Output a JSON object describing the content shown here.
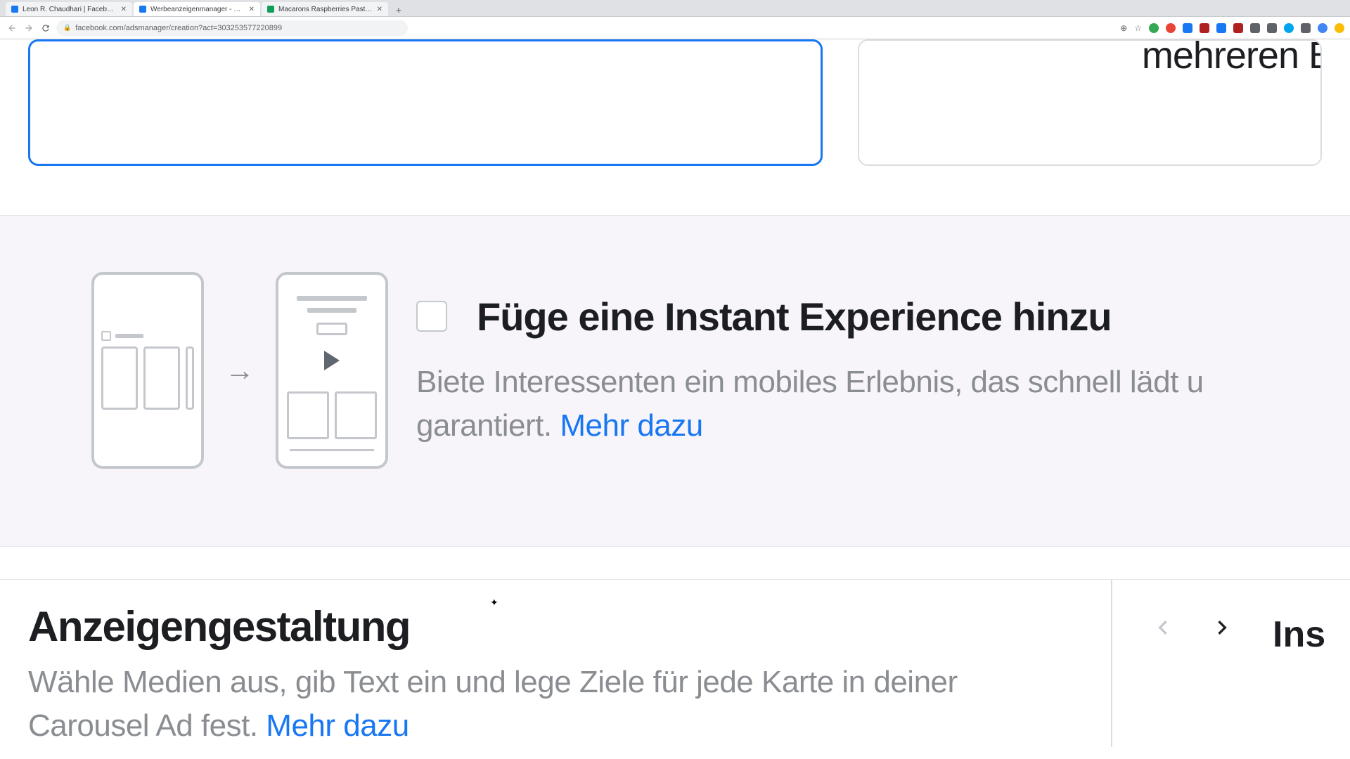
{
  "browser": {
    "tabs": [
      {
        "title": "Leon R. Chaudhari | Facebook",
        "active": false,
        "favicon": "blue"
      },
      {
        "title": "Werbeanzeigenmanager - Cre",
        "active": true,
        "favicon": "blue"
      },
      {
        "title": "Macarons Raspberries Pastries",
        "active": false,
        "favicon": "green"
      }
    ],
    "url": "facebook.com/adsmanager/creation?act=303253577220899"
  },
  "top_cards": {
    "other_partial_text": "mehreren Bil"
  },
  "instant_experience": {
    "title": "Füge eine Instant Experience hinzu",
    "description_part1": "Biete Interessenten ein mobiles Erlebnis, das schnell lädt u",
    "description_part2": "garantiert. ",
    "link_text": "Mehr dazu"
  },
  "ad_design": {
    "title": "Anzeigengestaltung",
    "description_line1": "Wähle Medien aus, gib Text ein und lege Ziele für jede Karte in deiner",
    "description_line2_prefix": "Carousel Ad fest. ",
    "link_text": "Mehr dazu",
    "side_label": "Ins"
  },
  "extension_colors": [
    "#34a853",
    "#ea4335",
    "#1877f2",
    "#af2121",
    "#1877f2",
    "#af2121",
    "#5f6368",
    "#5f6368",
    "#00a4ef",
    "#5f6368",
    "#4285f4",
    "#fbbc04"
  ]
}
